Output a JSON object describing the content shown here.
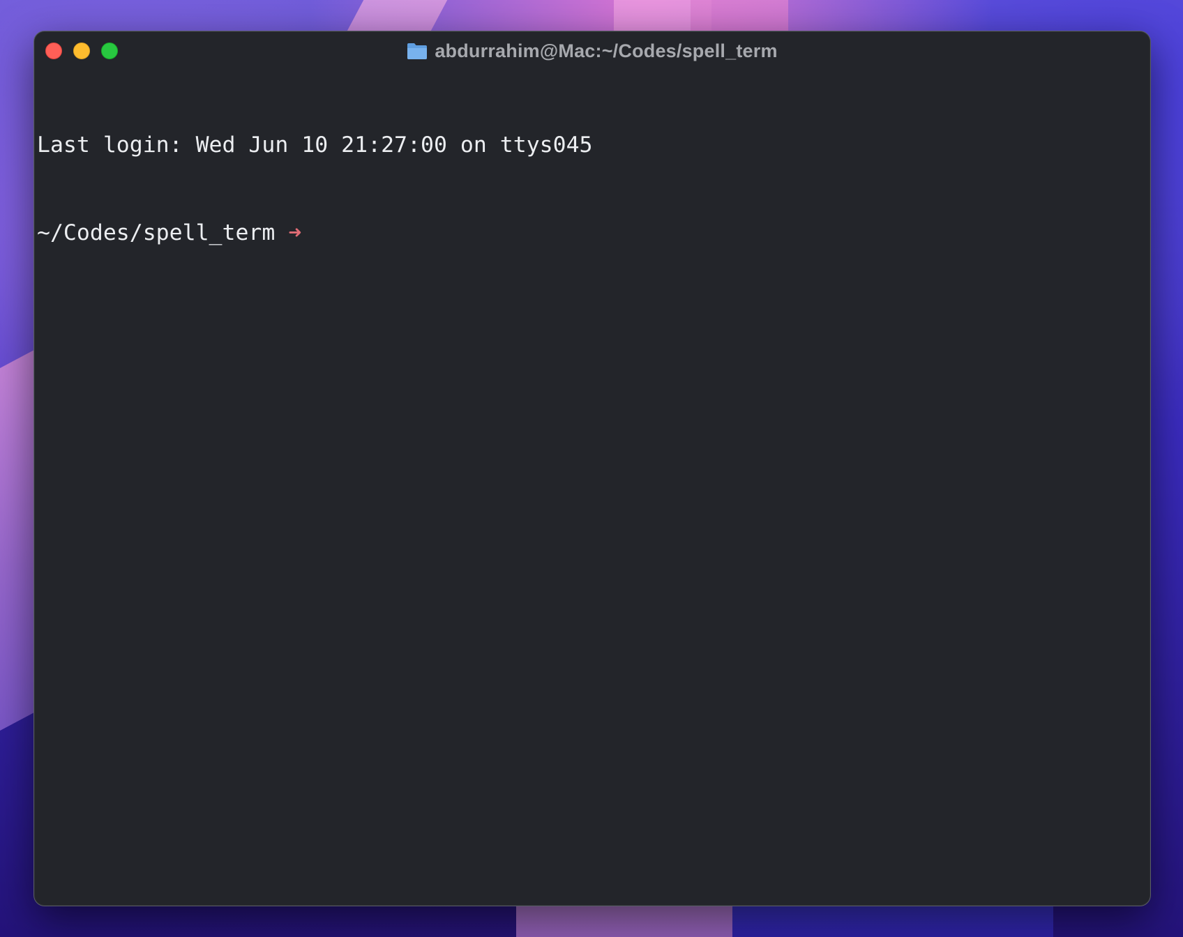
{
  "window": {
    "title": "abdurrahim@Mac:~/Codes/spell_term",
    "title_icon": "folder-icon",
    "traffic_lights": {
      "close_color": "#ff5f57",
      "minimize_color": "#febc2e",
      "zoom_color": "#28c840"
    }
  },
  "terminal": {
    "last_login_line": "Last login: Wed Jun 10 21:27:00 on ttys045",
    "prompt": {
      "path": "~/Codes/spell_term",
      "arrow": "➜",
      "arrow_color": "#e06c75"
    },
    "background_color": "#23252a",
    "text_color": "#eceef1"
  }
}
